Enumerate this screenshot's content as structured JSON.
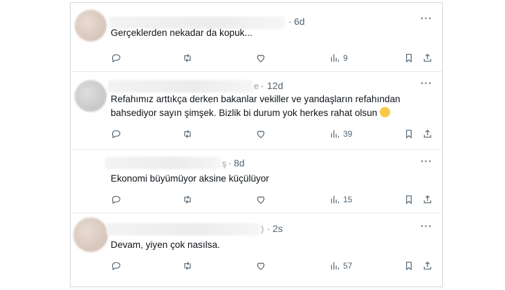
{
  "replies": [
    {
      "name_tail": "",
      "time": "6d",
      "text": "Gerçeklerden nekadar da kopuk...",
      "views": "9",
      "avatar": "beige"
    },
    {
      "name_tail": "e",
      "time": "12d",
      "text": "Refahımız arttıkça derken bakanlar vekiller ve yandaşların refahından bahsediyor sayın şimşek. Bizlik bi durum yok herkes rahat olsun",
      "emoji": "grinning-squinting-face-emoji",
      "views": "39",
      "avatar": "grey"
    },
    {
      "name_tail": "ş",
      "time": "8d",
      "text": "Ekonomi büyümüyor aksine küçülüyor",
      "views": "15",
      "avatar": "none"
    },
    {
      "name_tail": ")",
      "time": "2s",
      "text": "Devam, yiyen çok nasılsa.",
      "views": "57",
      "avatar": "beige"
    }
  ],
  "separator": "·",
  "more_label": "···",
  "icons": [
    "reply-icon",
    "retweet-icon",
    "like-icon",
    "views-icon",
    "bookmark-icon",
    "share-icon"
  ],
  "colors": {
    "muted": "#536471",
    "text": "#0f1419",
    "border": "#cfd9de"
  }
}
